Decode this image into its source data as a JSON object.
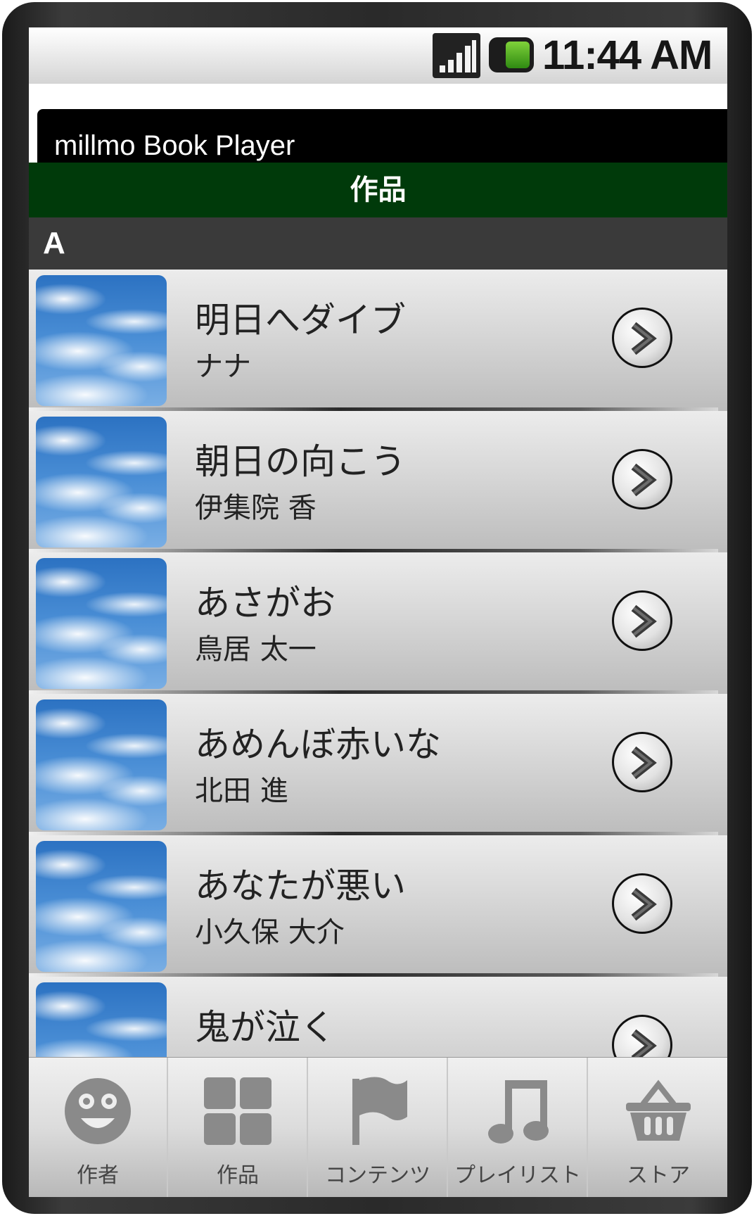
{
  "status_bar": {
    "time": "11:44 AM"
  },
  "app": {
    "title": "millmo Book Player"
  },
  "category": {
    "title": "作品"
  },
  "section": {
    "letter": "A"
  },
  "items": [
    {
      "title": "明日へダイブ",
      "author": "ナナ"
    },
    {
      "title": "朝日の向こう",
      "author": "伊集院 香"
    },
    {
      "title": "あさがお",
      "author": "鳥居 太一"
    },
    {
      "title": "あめんぼ赤いな",
      "author": "北田 進"
    },
    {
      "title": "あなたが悪い",
      "author": "小久保 大介"
    },
    {
      "title": "鬼が泣く",
      "author": ""
    }
  ],
  "tabs": [
    {
      "label": "作者",
      "icon": "face-icon"
    },
    {
      "label": "作品",
      "icon": "grid-icon"
    },
    {
      "label": "コンテンツ",
      "icon": "flag-icon"
    },
    {
      "label": "プレイリスト",
      "icon": "music-note-icon"
    },
    {
      "label": "ストア",
      "icon": "basket-icon"
    }
  ],
  "colors": {
    "category_header": "#003a0a",
    "section_header": "#3a3a3a",
    "title_bar": "#000000"
  }
}
